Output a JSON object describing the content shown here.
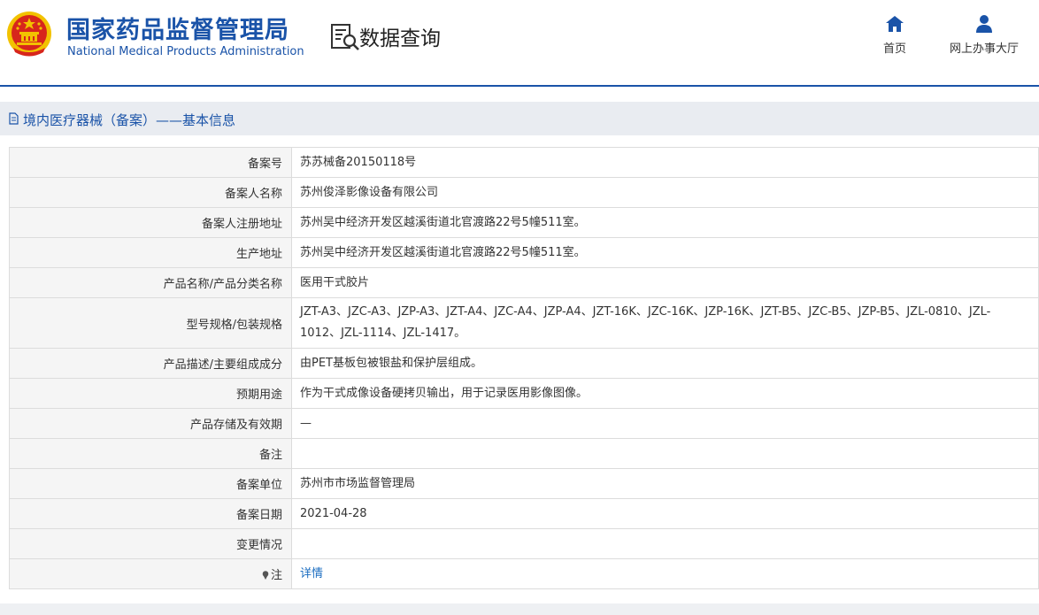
{
  "header": {
    "org_name_cn": "国家药品监督管理局",
    "org_name_en": "National Medical Products Administration",
    "query_title": "数据查询",
    "nav": [
      {
        "label": "首页",
        "icon": "home-icon"
      },
      {
        "label": "网上办事大厅",
        "icon": "user-icon"
      }
    ]
  },
  "section": {
    "title": "境内医疗器械（备案）——基本信息",
    "icon": "document-icon"
  },
  "record": [
    {
      "label": "备案号",
      "value": "苏苏械备20150118号"
    },
    {
      "label": "备案人名称",
      "value": "苏州俊泽影像设备有限公司"
    },
    {
      "label": "备案人注册地址",
      "value": "苏州吴中经济开发区越溪街道北官渡路22号5幢511室。"
    },
    {
      "label": "生产地址",
      "value": "苏州吴中经济开发区越溪街道北官渡路22号5幢511室。"
    },
    {
      "label": "产品名称/产品分类名称",
      "value": "医用干式胶片"
    },
    {
      "label": "型号规格/包装规格",
      "value": "JZT-A3、JZC-A3、JZP-A3、JZT-A4、JZC-A4、JZP-A4、JZT-16K、JZC-16K、JZP-16K、JZT-B5、JZC-B5、JZP-B5、JZL-0810、JZL-1012、JZL-1114、JZL-1417。"
    },
    {
      "label": "产品描述/主要组成成分",
      "value": "由PET基板包被银盐和保护层组成。"
    },
    {
      "label": "预期用途",
      "value": "作为干式成像设备硬拷贝输出，用于记录医用影像图像。"
    },
    {
      "label": "产品存储及有效期",
      "value": "—"
    },
    {
      "label": "备注",
      "value": ""
    },
    {
      "label": "备案单位",
      "value": "苏州市市场监督管理局"
    },
    {
      "label": "备案日期",
      "value": "2021-04-28"
    },
    {
      "label": "变更情况",
      "value": ""
    },
    {
      "label": "注",
      "value": "详情",
      "icon": "pin-icon"
    }
  ],
  "colors": {
    "brand_blue": "#1a53a8",
    "link_blue": "#1a6cc0",
    "label_bg": "#f5f5f5",
    "section_bg": "#e9ecf1",
    "emblem_red": "#d7261c",
    "emblem_gold": "#f2c200"
  }
}
